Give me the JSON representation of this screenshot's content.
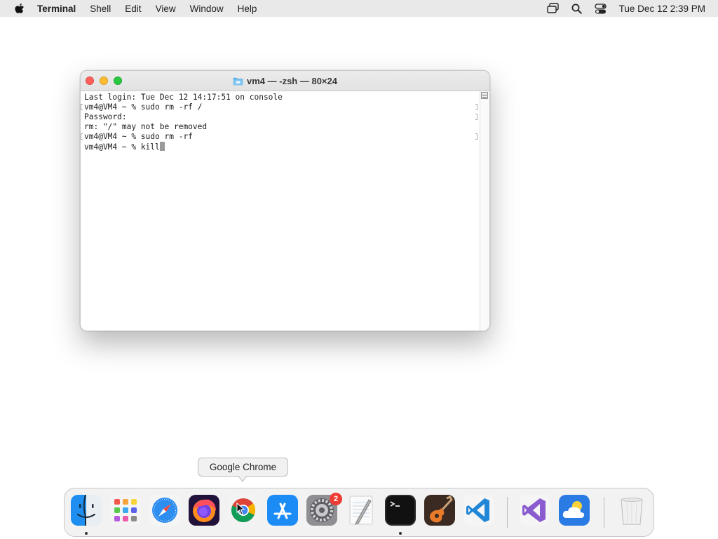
{
  "menubar": {
    "app_name": "Terminal",
    "menus": [
      "Shell",
      "Edit",
      "View",
      "Window",
      "Help"
    ],
    "clock": "Tue Dec 12  2:39 PM",
    "status_icons": [
      "screen-mirroring-icon",
      "search-icon",
      "control-center-icon"
    ]
  },
  "terminal": {
    "title": "vm4 — -zsh — 80×24",
    "lines": [
      "Last login: Tue Dec 12 14:17:51 on console",
      "vm4@VM4 ~ % sudo rm -rf /",
      "Password:",
      "rm: \"/\" may not be removed",
      "vm4@VM4 ~ % sudo rm -rf",
      "vm4@VM4 ~ % kill"
    ]
  },
  "tooltip": {
    "text": "Google Chrome"
  },
  "dock": {
    "items": [
      "Finder",
      "Launchpad",
      "Safari",
      "Firefox",
      "Google Chrome",
      "App Store",
      "System Settings",
      "TextEdit",
      "Terminal",
      "GarageBand",
      "Visual Studio Code",
      "Visual Studio",
      "Weather",
      "Trash"
    ],
    "settings_badge": "2"
  },
  "colors": {
    "close": "#fe5f57",
    "minimize": "#febc2e",
    "maximize": "#28c840",
    "badge": "#ee3b33"
  }
}
